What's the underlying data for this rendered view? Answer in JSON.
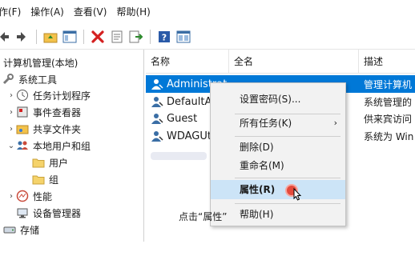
{
  "menubar": {
    "items": [
      "作(F)",
      "操作(A)",
      "查看(V)",
      "帮助(H)"
    ]
  },
  "toolbar": {
    "buttons": [
      "back-icon",
      "forward-icon",
      "up-folder-icon",
      "show-hide-tree-icon",
      "delete-icon",
      "properties-icon",
      "export-icon",
      "help-icon",
      "view-icon"
    ]
  },
  "tree": {
    "root": "计算机管理(本地)",
    "system_tools": "系统工具",
    "task_scheduler": "任务计划程序",
    "event_viewer": "事件查看器",
    "shared_folders": "共享文件夹",
    "local_users": "本地用户和组",
    "users": "用户",
    "groups": "组",
    "performance": "性能",
    "device_manager": "设备管理器",
    "storage": "存储"
  },
  "list": {
    "columns": [
      "名称",
      "全名",
      "描述"
    ],
    "rows": [
      {
        "name": "Administrat...",
        "desc": "管理计算机"
      },
      {
        "name": "DefaultAc",
        "desc": "系统管理的"
      },
      {
        "name": "Guest",
        "desc": "供来宾访问"
      },
      {
        "name": "WDAGUt",
        "desc": "系统为 Win"
      }
    ]
  },
  "context_menu": {
    "set_password": "设置密码(S)...",
    "all_tasks": "所有任务(K)",
    "all_tasks_arrow": "›",
    "delete": "删除(D)",
    "rename": "重命名(M)",
    "properties": "属性(R)",
    "help": "帮助(H)"
  },
  "caption": "点击“属性”",
  "colors": {
    "selection": "#0078d7",
    "menu_highlight": "#cce4f7",
    "click_marker": "#e44a3c"
  }
}
